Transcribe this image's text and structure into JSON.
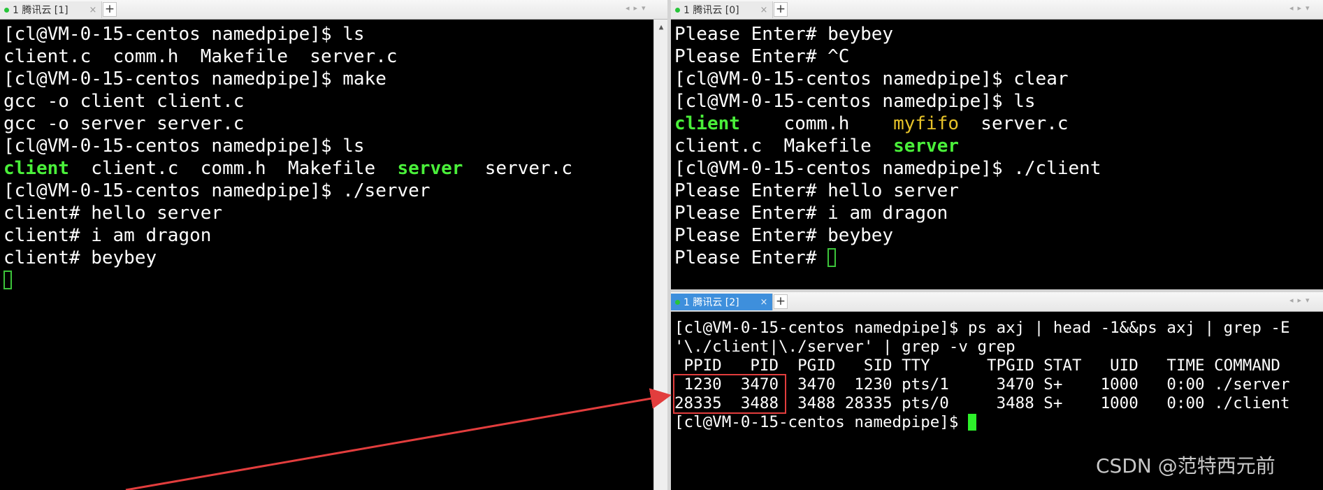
{
  "left_pane": {
    "tab_title": "1 腾讯云 [1]",
    "lines": [
      [
        {
          "t": "[cl@VM-0-15-centos namedpipe]$ ls"
        }
      ],
      [
        {
          "t": "client.c  comm.h  Makefile  server.c"
        }
      ],
      [
        {
          "t": "[cl@VM-0-15-centos namedpipe]$ make"
        }
      ],
      [
        {
          "t": "gcc -o client client.c"
        }
      ],
      [
        {
          "t": "gcc -o server server.c"
        }
      ],
      [
        {
          "t": "[cl@VM-0-15-centos namedpipe]$ ls"
        }
      ],
      [
        {
          "t": "client",
          "c": "green"
        },
        {
          "t": "  client.c  comm.h  Makefile  "
        },
        {
          "t": "server",
          "c": "green"
        },
        {
          "t": "  server.c"
        }
      ],
      [
        {
          "t": "[cl@VM-0-15-centos namedpipe]$ ./server"
        }
      ],
      [
        {
          "t": "client# hello server"
        }
      ],
      [
        {
          "t": "client# i am dragon"
        }
      ],
      [
        {
          "t": "client# beybey"
        }
      ]
    ]
  },
  "top_right_pane": {
    "tab_title": "1 腾讯云 [0]",
    "lines": [
      [
        {
          "t": "Please Enter# beybey"
        }
      ],
      [
        {
          "t": "Please Enter# ^C"
        }
      ],
      [
        {
          "t": "[cl@VM-0-15-centos namedpipe]$ clear"
        }
      ],
      [
        {
          "t": "[cl@VM-0-15-centos namedpipe]$ ls"
        }
      ],
      [
        {
          "t": "client",
          "c": "green"
        },
        {
          "t": "    comm.h    "
        },
        {
          "t": "myfifo",
          "c": "yellow"
        },
        {
          "t": "  server.c"
        }
      ],
      [
        {
          "t": "client.c  Makefile  "
        },
        {
          "t": "server",
          "c": "green"
        }
      ],
      [
        {
          "t": "[cl@VM-0-15-centos namedpipe]$ ./client"
        }
      ],
      [
        {
          "t": "Please Enter# hello server"
        }
      ],
      [
        {
          "t": "Please Enter# i am dragon"
        }
      ],
      [
        {
          "t": "Please Enter# beybey"
        }
      ],
      [
        {
          "t": "Please Enter# "
        }
      ]
    ]
  },
  "bottom_right_pane": {
    "tab_title": "1 腾讯云 [2]",
    "lines": [
      [
        {
          "t": "[cl@VM-0-15-centos namedpipe]$ ps axj | head -1&&ps axj | grep -E"
        }
      ],
      [
        {
          "t": "'\\./client|\\./server' | grep -v grep"
        }
      ],
      [
        {
          "t": " PPID   PID  PGID   SID TTY      TPGID STAT   UID   TIME COMMAND"
        }
      ],
      [
        {
          "t": " 1230  3470  3470  1230 pts/1     3470 S+    1000   0:00 ./server"
        }
      ],
      [
        {
          "t": "28335  3488  3488 28335 pts/0     3488 S+    1000   0:00 ./client"
        }
      ],
      [
        {
          "t": "[cl@VM-0-15-centos namedpipe]$ "
        }
      ]
    ]
  },
  "tab_close_glyph": "×",
  "new_tab_glyph": "+",
  "watermark": "CSDN @范特西元前",
  "colors": {
    "terminal_bg": "#000000",
    "text": "#ffffff",
    "exec_green": "#4af03a",
    "fifo_yellow": "#e6c229",
    "active_tab": "#3e8fdc",
    "annotation_red": "#e23d3d"
  }
}
